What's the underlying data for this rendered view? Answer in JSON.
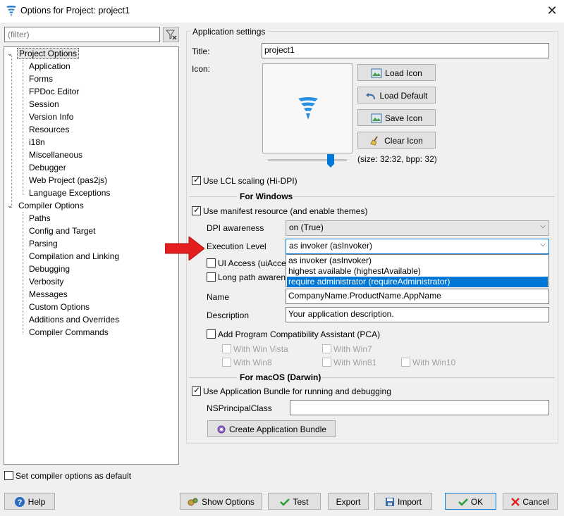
{
  "window": {
    "title": "Options for Project: project1",
    "close_glyph": "✕"
  },
  "filter": {
    "placeholder": "(filter)"
  },
  "tree": {
    "groups": [
      {
        "label": "Project Options",
        "selected": true,
        "children": [
          "Application",
          "Forms",
          "FPDoc Editor",
          "Session",
          "Version Info",
          "Resources",
          "i18n",
          "Miscellaneous",
          "Debugger",
          "Web Project (pas2js)",
          "Language Exceptions"
        ]
      },
      {
        "label": "Compiler Options",
        "selected": false,
        "children": [
          "Paths",
          "Config and Target",
          "Parsing",
          "Compilation and Linking",
          "Debugging",
          "Verbosity",
          "Messages",
          "Custom Options",
          "Additions and Overrides",
          "Compiler Commands"
        ]
      }
    ]
  },
  "set_default": {
    "label": "Set compiler options as default",
    "checked": false
  },
  "app_settings": {
    "group_title": "Application settings",
    "title_label": "Title:",
    "title_value": "project1",
    "icon_label": "Icon:",
    "load_icon": "Load Icon",
    "load_default": "Load Default",
    "save_icon": "Save Icon",
    "clear_icon": "Clear Icon",
    "size_info": "(size: 32:32, bpp: 32)",
    "lcl_scaling": "Use LCL scaling (Hi-DPI)",
    "lcl_scaling_checked": true,
    "icon_slider_fraction": 0.8
  },
  "windows": {
    "header": "For Windows",
    "manifest": "Use manifest resource (and enable themes)",
    "manifest_checked": true,
    "dpi_label": "DPI awareness",
    "dpi_value": "on (True)",
    "exec_label": "Execution Level",
    "exec_value": "as invoker (asInvoker)",
    "exec_options": [
      "as invoker (asInvoker)",
      "highest available (highestAvailable)",
      "require administrator (requireAdministrator)"
    ],
    "exec_highlighted_index": 2,
    "ui_access": "UI Access (uiAccess)",
    "long_path": "Long path awareness",
    "name_label": "Name",
    "name_value": "CompanyName.ProductName.AppName",
    "desc_label": "Description",
    "desc_value": "Your application description.",
    "pca": "Add Program Compatibility Assistant (PCA)",
    "pca_options": [
      "With Win Vista",
      "With Win7",
      "With Win8",
      "With Win81",
      "With Win10"
    ]
  },
  "macos": {
    "header": "For macOS (Darwin)",
    "bundle": "Use Application Bundle for running and debugging",
    "bundle_checked": true,
    "ns_label": "NSPrincipalClass",
    "ns_value": "",
    "create_bundle": "Create Application Bundle"
  },
  "footer": {
    "help": "Help",
    "show_options": "Show Options",
    "test": "Test",
    "export": "Export",
    "import": "Import",
    "ok": "OK",
    "cancel": "Cancel"
  },
  "colors": {
    "accent": "#0078d7",
    "arrow": "#e41e1e",
    "ok_check": "#2a9d3a",
    "cancel_x": "#d22"
  }
}
